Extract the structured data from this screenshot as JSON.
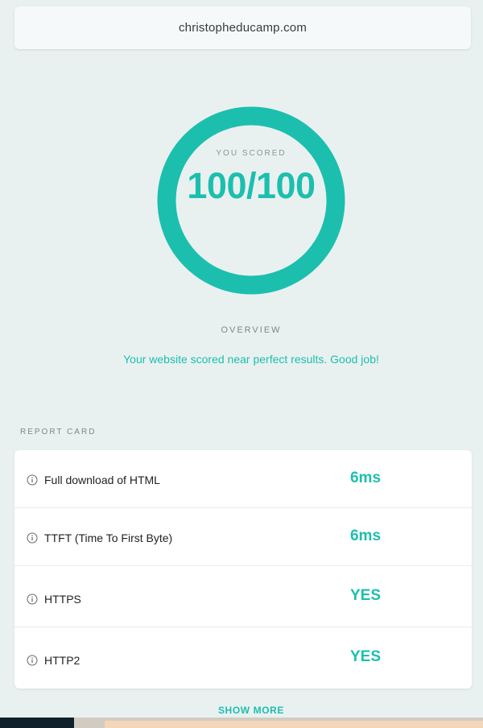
{
  "header": {
    "url": "christopheducamp.com"
  },
  "score": {
    "label": "YOU SCORED",
    "value": "100/100",
    "fraction": 1.0
  },
  "overview": {
    "heading": "OVERVIEW",
    "text": "Your website scored near perfect results. Good job!"
  },
  "report_card": {
    "heading": "REPORT CARD",
    "rows": [
      {
        "label": "Full download of HTML",
        "value": "6ms"
      },
      {
        "label": "TTFT (Time To First Byte)",
        "value": "6ms"
      },
      {
        "label": "HTTPS",
        "value": "YES"
      },
      {
        "label": "HTTP2",
        "value": "YES"
      }
    ],
    "show_more_label": "SHOW MORE"
  },
  "colors": {
    "accent": "#1cbfae",
    "background": "#e9f1f0"
  },
  "icons": {
    "row_icon": "info-icon"
  }
}
